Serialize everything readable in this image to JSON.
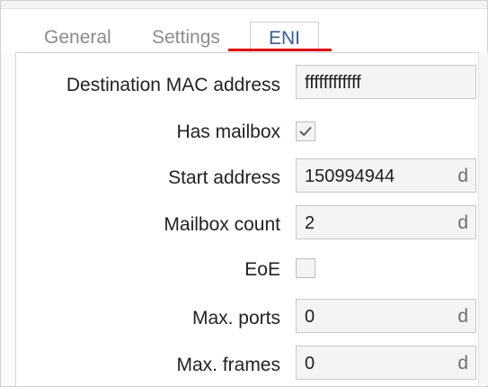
{
  "tabs": {
    "general": "General",
    "settings": "Settings",
    "eni": "ENI"
  },
  "form": {
    "destination_mac": {
      "label": "Destination MAC address",
      "value": "ffffffffffff"
    },
    "has_mailbox": {
      "label": "Has mailbox",
      "checked": true
    },
    "start_address": {
      "label": "Start address",
      "value": "150994944",
      "unit": "d"
    },
    "mailbox_count": {
      "label": "Mailbox count",
      "value": "2",
      "unit": "d"
    },
    "eoe": {
      "label": "EoE",
      "checked": false
    },
    "max_ports": {
      "label": "Max. ports",
      "value": "0",
      "unit": "d"
    },
    "max_frames": {
      "label": "Max. frames",
      "value": "0",
      "unit": "d"
    }
  },
  "colors": {
    "active_tab_underline": "#e00000",
    "active_tab_text": "#3b5e91"
  }
}
